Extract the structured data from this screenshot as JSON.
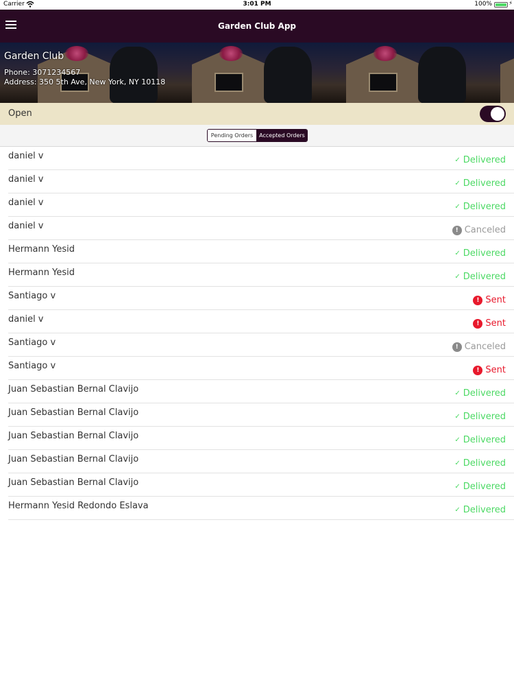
{
  "statusbar": {
    "carrier": "Carrier",
    "time": "3:01 PM",
    "battery": "100%"
  },
  "navbar": {
    "title": "Garden Club App"
  },
  "store": {
    "name": "Garden Club",
    "phone": "Phone: 3071234567",
    "address": "Address: 350 5th Ave, New York, NY 10118"
  },
  "open_toggle": {
    "label": "Open",
    "on": true
  },
  "tabs": {
    "pending": "Pending Orders",
    "accepted": "Accepted Orders",
    "selected": "accepted"
  },
  "colors": {
    "brand": "#2a0a24",
    "delivered": "#4cd964",
    "sent": "#e8192c",
    "canceled": "#8a8a8a",
    "open_bar": "#ece4c8"
  },
  "orders": [
    {
      "customer": "daniel v",
      "status": "Delivered",
      "kind": "delivered"
    },
    {
      "customer": "daniel v",
      "status": "Delivered",
      "kind": "delivered"
    },
    {
      "customer": "daniel v",
      "status": "Delivered",
      "kind": "delivered"
    },
    {
      "customer": "daniel v",
      "status": "Canceled",
      "kind": "canceled"
    },
    {
      "customer": "Hermann Yesid",
      "status": "Delivered",
      "kind": "delivered"
    },
    {
      "customer": "Hermann Yesid",
      "status": "Delivered",
      "kind": "delivered"
    },
    {
      "customer": "Santiago v",
      "status": "Sent",
      "kind": "sent"
    },
    {
      "customer": "daniel v",
      "status": "Sent",
      "kind": "sent"
    },
    {
      "customer": "Santiago v",
      "status": "Canceled",
      "kind": "canceled"
    },
    {
      "customer": "Santiago v",
      "status": "Sent",
      "kind": "sent"
    },
    {
      "customer": "Juan Sebastian Bernal Clavijo",
      "status": "Delivered",
      "kind": "delivered"
    },
    {
      "customer": "Juan Sebastian Bernal Clavijo",
      "status": "Delivered",
      "kind": "delivered"
    },
    {
      "customer": "Juan Sebastian Bernal Clavijo",
      "status": "Delivered",
      "kind": "delivered"
    },
    {
      "customer": "Juan Sebastian Bernal Clavijo",
      "status": "Delivered",
      "kind": "delivered"
    },
    {
      "customer": "Juan Sebastian Bernal Clavijo",
      "status": "Delivered",
      "kind": "delivered"
    },
    {
      "customer": "Hermann Yesid Redondo Eslava",
      "status": "Delivered",
      "kind": "delivered"
    }
  ]
}
